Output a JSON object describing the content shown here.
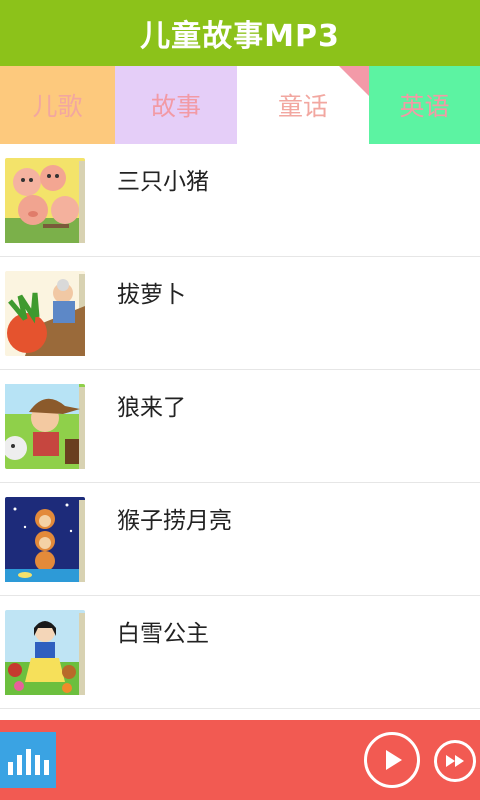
{
  "app": {
    "title": "儿童故事MP3"
  },
  "tabs": [
    {
      "label": "儿歌",
      "bg": "#fdc97d",
      "color": "#f2a7a0"
    },
    {
      "label": "故事",
      "bg": "#e5cef8",
      "color": "#f29aa5"
    },
    {
      "label": "童话",
      "bg": "#ffffff",
      "color": "#f2a7a0"
    },
    {
      "label": "英语",
      "bg": "#5cf3a2",
      "color": "#f29aa5"
    }
  ],
  "stories": [
    {
      "title": "三只小猪"
    },
    {
      "title": "拔萝卜"
    },
    {
      "title": "狼来了"
    },
    {
      "title": "猴子捞月亮"
    },
    {
      "title": "白雪公主"
    }
  ],
  "player": {
    "icons": [
      "equalizer-icon",
      "play-icon",
      "fast-forward-icon"
    ],
    "bar_color": "#f25a52",
    "eq_color": "#3aa3e3"
  }
}
